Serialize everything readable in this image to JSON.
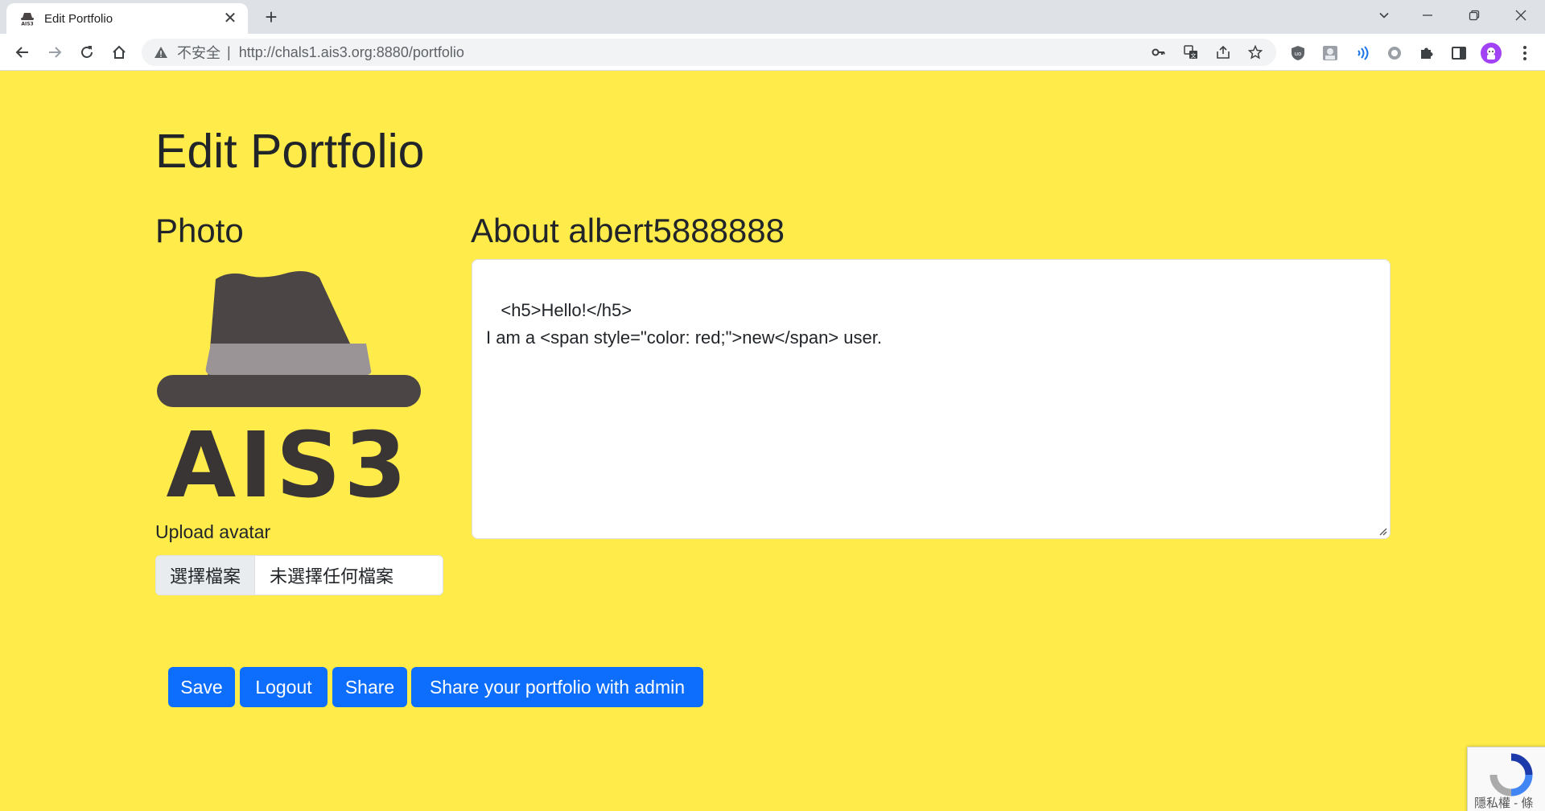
{
  "browser": {
    "tab_title": "Edit Portfolio",
    "tab_close": "✕",
    "new_tab": "+",
    "insecure_label": "不安全",
    "separator": "|",
    "url_host": "http://chals1.ais3.org:8880",
    "url_path": "/portfolio"
  },
  "page": {
    "title": "Edit Portfolio",
    "photo_heading": "Photo",
    "about_heading": "About albert5888888",
    "logo_text": "AIS3",
    "upload_label": "Upload avatar",
    "file_button": "選擇檔案",
    "file_status": "未選擇任何檔案",
    "about_content": " <h5>Hello!</h5>\nI am a <span style=\"color: red;\">new</span> user."
  },
  "buttons": {
    "save": "Save",
    "logout": "Logout",
    "share": "Share",
    "share_admin": "Share your portfolio with admin"
  },
  "recaptcha": {
    "footer_text": "隱私權 - 條"
  },
  "colors": {
    "page_background": "#ffec4a",
    "primary_button": "#0d6efd",
    "hat_dark": "#4b4545",
    "hat_band": "#9a9496",
    "logo_text": "#3a3535"
  }
}
